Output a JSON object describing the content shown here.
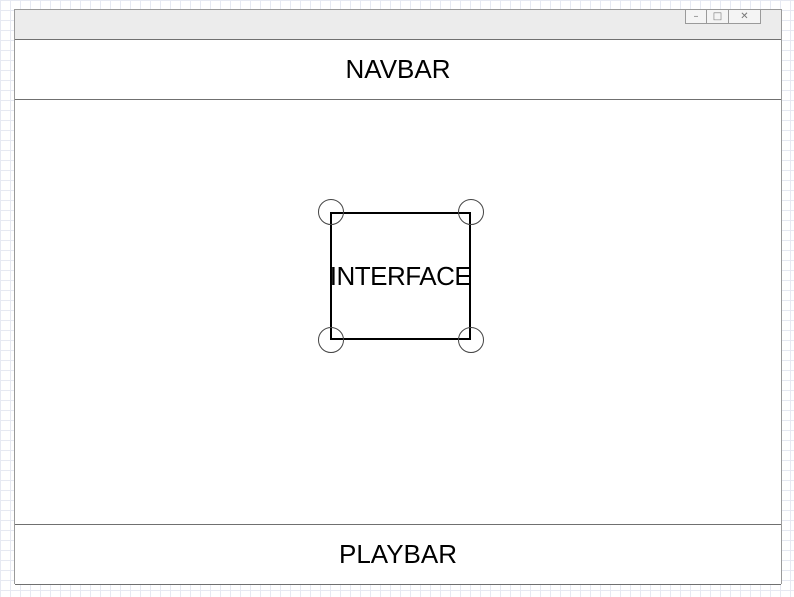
{
  "window": {
    "controls": {
      "minimize": "–",
      "maximize": "□",
      "close": "✕"
    }
  },
  "navbar": {
    "label": "NAVBAR"
  },
  "interface": {
    "label": "INTERFACE"
  },
  "playbar": {
    "label": "PLAYBAR"
  }
}
